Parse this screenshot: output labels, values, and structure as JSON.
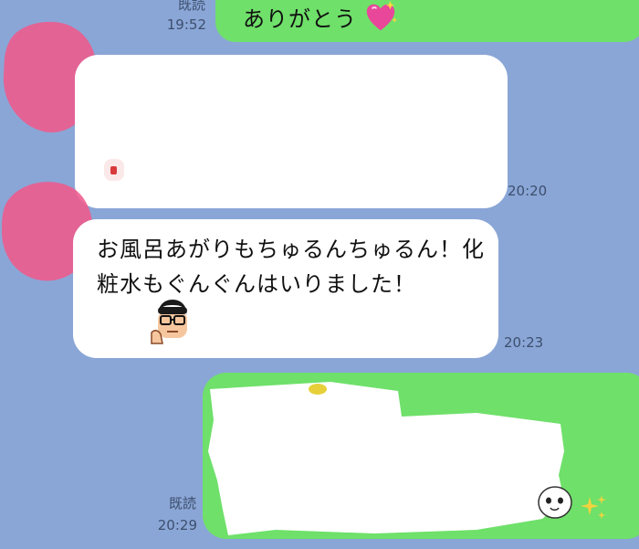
{
  "messages": [
    {
      "side": "sent",
      "read_label": "既読",
      "time": "19:52",
      "text": "ありがとう",
      "emoji": "sparkling-heart"
    },
    {
      "side": "received",
      "time": "20:20",
      "text": "",
      "redacted": true
    },
    {
      "side": "received",
      "time": "20:23",
      "text": "お風呂あがりもちゅるんちゅるん！化粧水もぐんぐんはいりました！",
      "sticker": "glasses-man-thumbs-up"
    },
    {
      "side": "sent",
      "read_label": "既読",
      "time": "20:29",
      "text": "",
      "redacted": true,
      "emoji": "sparkles"
    }
  ],
  "colors": {
    "background": "#8aa6d6",
    "sent_bubble": "#6fe06a",
    "received_bubble": "#ffffff",
    "redaction_pink": "#ef5a8c"
  }
}
